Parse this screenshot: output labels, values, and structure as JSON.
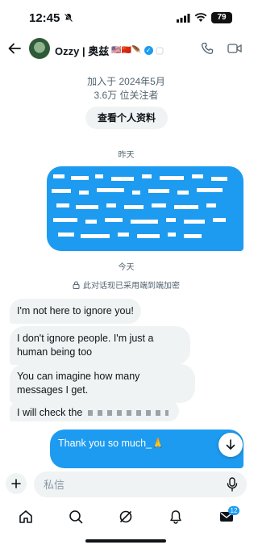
{
  "status_bar": {
    "time": "12:45",
    "battery": "79"
  },
  "header": {
    "name": "Ozzy | 奥兹",
    "emojis": "🇺🇸🇨🇳🪶",
    "verified_mark": "✓"
  },
  "profile": {
    "joined": "加入于 2024年5月",
    "followers": "3.6万 位关注者",
    "view_profile_label": "查看个人资料"
  },
  "conversation": {
    "day_yesterday": "昨天",
    "day_today": "今天",
    "encryption_notice": "此对话现已采用端到端加密",
    "incoming": [
      "I'm not here to ignore you!",
      "I don't ignore people. I'm just a human being too",
      "You can imagine how many messages I get.",
      "I will check the"
    ],
    "outgoing_last": "Thank you so much_🙏"
  },
  "composer": {
    "placeholder": "私信"
  },
  "nav": {
    "messages_badge": "12"
  },
  "colors": {
    "accent": "#1d9bf0",
    "bubble_in": "#eff3f4",
    "text": "#0f1419",
    "muted": "#536471"
  }
}
